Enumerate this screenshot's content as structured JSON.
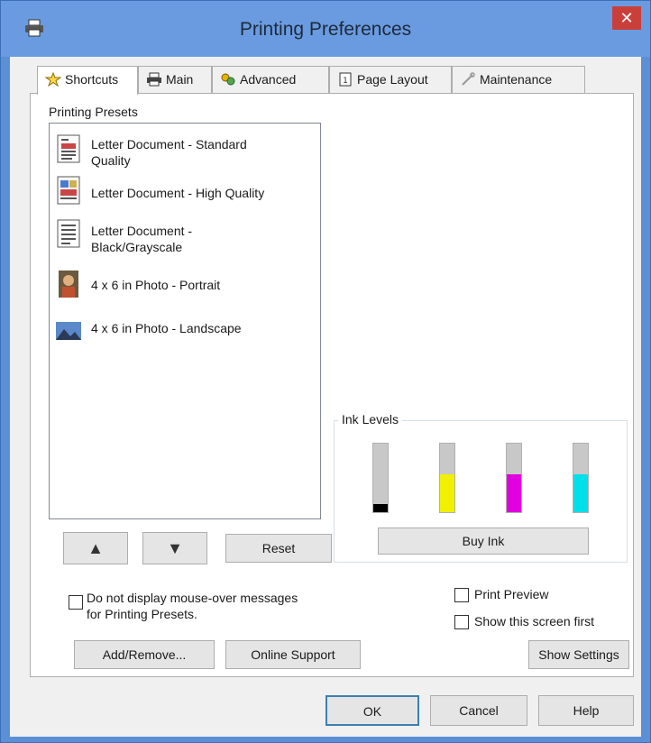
{
  "window": {
    "title": "Printing Preferences",
    "close_glyph": "✕",
    "printer_icon": "printer-icon"
  },
  "tabs": [
    {
      "label": "Shortcuts",
      "icon": "star-icon",
      "active": true
    },
    {
      "label": "Main",
      "icon": "printer-icon",
      "active": false
    },
    {
      "label": "Advanced",
      "icon": "gears-icon",
      "active": false
    },
    {
      "label": "Page Layout",
      "icon": "page-icon",
      "active": false
    },
    {
      "label": "Maintenance",
      "icon": "wrench-icon",
      "active": false
    }
  ],
  "presets": {
    "label": "Printing Presets",
    "items": [
      {
        "line1": "Letter Document - Standard",
        "line2": "Quality",
        "icon": "document-color-icon"
      },
      {
        "line1": "Letter Document - High Quality",
        "line2": "",
        "icon": "document-photo-icon"
      },
      {
        "line1": "Letter Document -",
        "line2": "Black/Grayscale",
        "icon": "document-bw-icon"
      },
      {
        "line1": "4 x 6 in Photo - Portrait",
        "line2": "",
        "icon": "photo-portrait-icon"
      },
      {
        "line1": "4 x 6 in Photo - Landscape",
        "line2": "",
        "icon": "photo-landscape-icon"
      }
    ]
  },
  "ink_levels": {
    "label": "Ink Levels",
    "cartridges": [
      {
        "color": "#000000",
        "level": 0.12
      },
      {
        "color": "#f0f000",
        "level": 0.55
      },
      {
        "color": "#e000e0",
        "level": 0.55
      },
      {
        "color": "#00e0e8",
        "level": 0.55
      }
    ],
    "buy_label": "Buy Ink"
  },
  "controls": {
    "move_up": "▲",
    "move_down": "▼",
    "reset": "Reset",
    "mouseover_line1": "Do not display mouse-over messages",
    "mouseover_line2": "for Printing Presets.",
    "print_preview": "Print Preview",
    "show_first": "Show this screen first",
    "add_remove": "Add/Remove...",
    "online_support": "Online Support",
    "show_settings": "Show Settings"
  },
  "footer": {
    "ok": "OK",
    "cancel": "Cancel",
    "help": "Help"
  }
}
